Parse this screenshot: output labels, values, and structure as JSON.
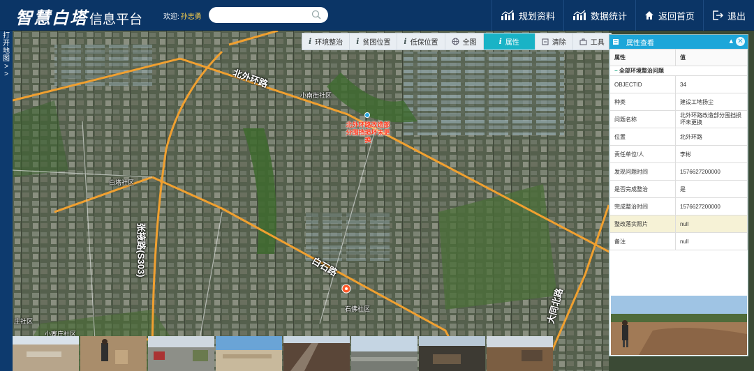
{
  "header": {
    "logo_main": "智慧白塔",
    "logo_sub": "信息平台",
    "welcome_label": "欢迎:",
    "user_name": "孙志勇",
    "search_placeholder": "",
    "nav": [
      {
        "label": "规划资料",
        "icon": "bar-chart-icon"
      },
      {
        "label": "数据统计",
        "icon": "bar-chart-icon"
      },
      {
        "label": "返回首页",
        "icon": "home-icon"
      },
      {
        "label": "退出",
        "icon": "logout-icon"
      }
    ]
  },
  "side_toggle": {
    "label": "打开地图>>"
  },
  "toolbar": {
    "items": [
      {
        "label": "环境整治",
        "icon": "info-icon"
      },
      {
        "label": "贫困位置",
        "icon": "info-icon"
      },
      {
        "label": "低保位置",
        "icon": "info-icon"
      },
      {
        "label": "全图",
        "icon": "globe-icon"
      },
      {
        "label": "属性",
        "icon": "info-icon",
        "active": true
      },
      {
        "label": "清除",
        "icon": "clear-icon"
      },
      {
        "label": "工具",
        "icon": "toolbox-icon"
      }
    ]
  },
  "map": {
    "roads": {
      "north": "北外环路",
      "baishi": "白石路",
      "zhangye": "张掖路(S303)",
      "east": "大同北路"
    },
    "places": {
      "xiaonan": "小南街社区",
      "baita": "白塔社区",
      "shibei": "石佛社区",
      "zhuang": "庄社区",
      "xiaoluo": "小寨庄社区"
    },
    "marker_label": "北外环路改造部分围挡损坏未更换",
    "colors": {
      "road": "#f0a030",
      "marker": "#ff3b1f"
    }
  },
  "panel": {
    "title": "属性查看",
    "col_attr": "属性",
    "col_val": "值",
    "group": "全部环境整治问题",
    "rows": [
      {
        "k": "OBJECTID",
        "v": "34"
      },
      {
        "k": "种类",
        "v": "建设工地扬尘"
      },
      {
        "k": "问题名称",
        "v": "北外环路改造部分围挡损坏未更换"
      },
      {
        "k": "位置",
        "v": "北外环路"
      },
      {
        "k": "责任单位/人",
        "v": "李彬"
      },
      {
        "k": "发现问题时间",
        "v": "1576627200000"
      },
      {
        "k": "是否完成整治",
        "v": "是"
      },
      {
        "k": "完成整治时间",
        "v": "1576627200000"
      },
      {
        "k": "整改落实照片",
        "v": "null"
      },
      {
        "k": "备注",
        "v": "null"
      }
    ]
  }
}
